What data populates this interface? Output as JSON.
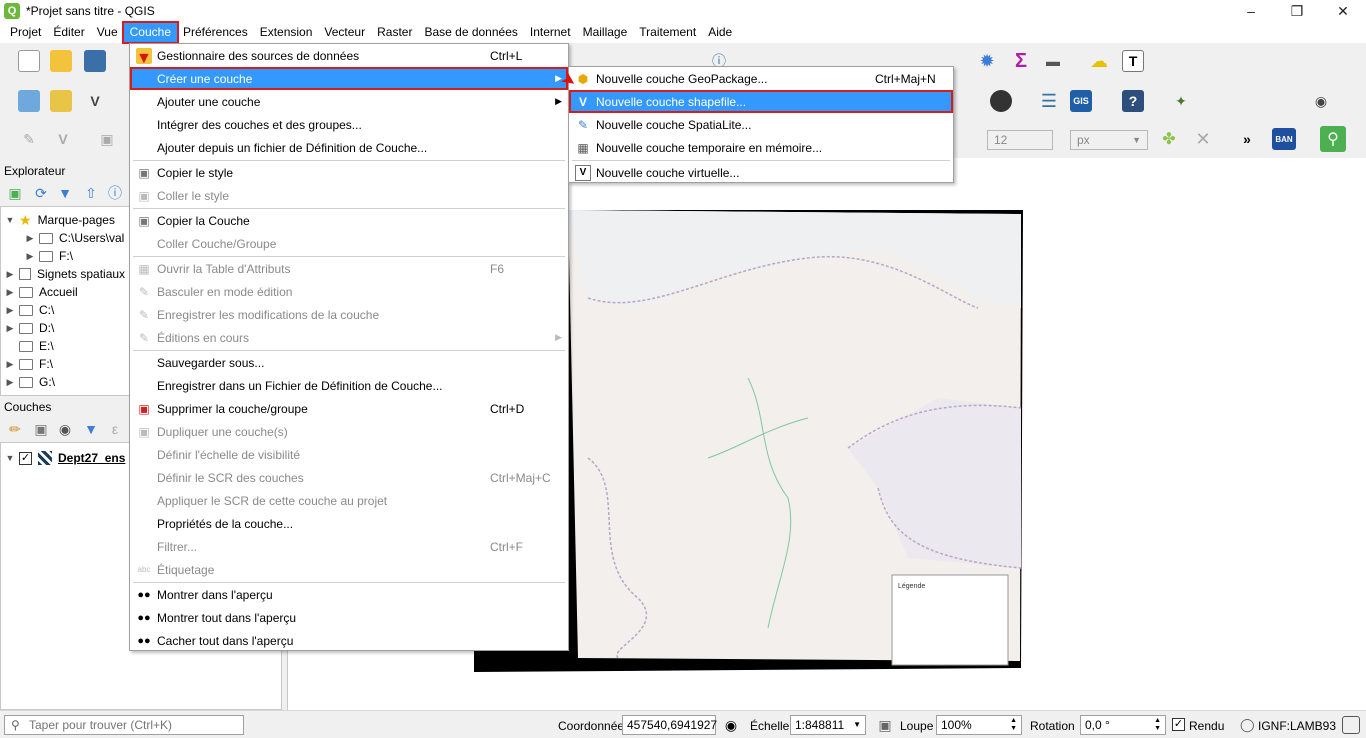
{
  "window": {
    "title": "*Projet sans titre - QGIS",
    "app_icon": "qgis-icon",
    "controls": [
      "minimize",
      "maximize",
      "close"
    ]
  },
  "menubar": {
    "items": [
      "Projet",
      "Éditer",
      "Vue",
      "Couche",
      "Préférences",
      "Extension",
      "Vecteur",
      "Raster",
      "Base de données",
      "Internet",
      "Maillage",
      "Traitement",
      "Aide"
    ],
    "active": "Couche"
  },
  "couche_menu": {
    "items": [
      {
        "label": "Gestionnaire des sources de données",
        "shortcut": "Ctrl+L",
        "icon": "data-source-manager-icon"
      },
      {
        "label": "Créer une couche",
        "submenu": true,
        "highlighted": true
      },
      {
        "label": "Ajouter une couche",
        "submenu": true
      },
      {
        "label": "Intégrer des couches et des groupes..."
      },
      {
        "label": "Ajouter depuis un fichier de Définition de Couche..."
      },
      {
        "label": "Copier le style",
        "icon": "copy-style-icon"
      },
      {
        "label": "Coller le style",
        "disabled": true,
        "icon": "paste-style-icon"
      },
      {
        "label": "Copier la Couche",
        "icon": "copy-layer-icon"
      },
      {
        "label": "Coller Couche/Groupe",
        "disabled": true
      },
      {
        "label": "Ouvrir la Table d'Attributs",
        "shortcut": "F6",
        "disabled": true,
        "icon": "attribute-table-icon"
      },
      {
        "label": "Basculer en mode édition",
        "disabled": true,
        "icon": "pencil-icon"
      },
      {
        "label": "Enregistrer les modifications de la couche",
        "disabled": true,
        "icon": "save-edits-icon"
      },
      {
        "label": "Éditions en cours",
        "disabled": true,
        "submenu": true,
        "icon": "edits-icon"
      },
      {
        "label": "Sauvegarder sous..."
      },
      {
        "label": "Enregistrer dans un Fichier de Définition de Couche..."
      },
      {
        "label": "Supprimer la couche/groupe",
        "shortcut": "Ctrl+D",
        "icon": "remove-layer-icon"
      },
      {
        "label": "Dupliquer une couche(s)",
        "disabled": true,
        "icon": "duplicate-layer-icon"
      },
      {
        "label": "Définir l'échelle de visibilité",
        "disabled": true
      },
      {
        "label": "Définir le SCR des couches",
        "shortcut": "Ctrl+Maj+C",
        "disabled": true
      },
      {
        "label": "Appliquer le SCR de cette couche au projet",
        "disabled": true
      },
      {
        "label": "Propriétés de la couche..."
      },
      {
        "label": "Filtrer...",
        "shortcut": "Ctrl+F",
        "disabled": true
      },
      {
        "label": "Étiquetage",
        "disabled": true,
        "icon": "label-icon"
      },
      {
        "label": "Montrer dans l'aperçu",
        "icon": "overview-show-icon"
      },
      {
        "label": "Montrer tout dans l'aperçu",
        "icon": "overview-all-icon"
      },
      {
        "label": "Cacher tout dans l'aperçu",
        "icon": "overview-hide-icon"
      }
    ]
  },
  "create_submenu": {
    "items": [
      {
        "label": "Nouvelle couche GeoPackage...",
        "shortcut": "Ctrl+Maj+N",
        "icon": "geopackage-icon"
      },
      {
        "label": "Nouvelle couche shapefile...",
        "highlighted": true,
        "icon": "shapefile-icon"
      },
      {
        "label": "Nouvelle couche SpatiaLite...",
        "icon": "spatialite-icon"
      },
      {
        "label": "Nouvelle couche temporaire en mémoire...",
        "icon": "memory-layer-icon"
      },
      {
        "label": "Nouvelle couche virtuelle...",
        "icon": "virtual-layer-icon"
      }
    ]
  },
  "browser": {
    "title": "Explorateur",
    "items": [
      {
        "label": "Marque-pages",
        "level": 0,
        "icon": "star-icon",
        "expanded": true
      },
      {
        "label": "C:\\Users\\val",
        "level": 1,
        "icon": "folder-icon"
      },
      {
        "label": "F:\\",
        "level": 1,
        "icon": "folder-icon"
      },
      {
        "label": "Signets spatiaux",
        "level": 0,
        "icon": "spatial-bookmark-icon"
      },
      {
        "label": "Accueil",
        "level": 0,
        "icon": "folder-icon"
      },
      {
        "label": "C:\\",
        "level": 0,
        "icon": "folder-icon"
      },
      {
        "label": "D:\\",
        "level": 0,
        "icon": "folder-icon"
      },
      {
        "label": "E:\\",
        "level": 0,
        "icon": "folder-icon"
      },
      {
        "label": "F:\\",
        "level": 0,
        "icon": "folder-icon"
      },
      {
        "label": "G:\\",
        "level": 0,
        "icon": "folder-icon"
      }
    ]
  },
  "layers": {
    "title": "Couches",
    "items": [
      {
        "label": "Dept27_ens",
        "checked": true,
        "icon": "raster-layer-icon"
      }
    ]
  },
  "toolbar": {
    "font_size_value": "12",
    "font_unit_value": "px",
    "ban_label": "BAN",
    "more_label": "»"
  },
  "statusbar": {
    "search_placeholder": "Taper pour trouver (Ctrl+K)",
    "coord_label": "Coordonnée",
    "coord_value": "457540,6941927",
    "scale_label": "Échelle",
    "scale_value": "1:848811",
    "zoom_label": "Loupe",
    "zoom_value": "100%",
    "rotation_label": "Rotation",
    "rotation_value": "0,0 °",
    "render_label": "Rendu",
    "render_checked": true,
    "crs_label": "IGNF:LAMB93"
  },
  "colors": {
    "accent": "#3399ff",
    "highlight_outline": "#d81b1b"
  }
}
